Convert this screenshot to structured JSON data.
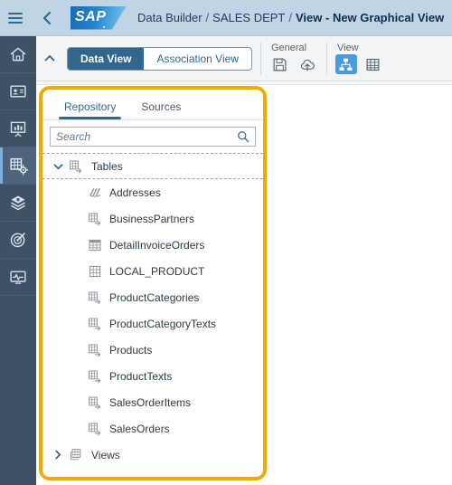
{
  "header": {
    "menu_icon": "hamburger-icon",
    "back_icon": "chevron-left-icon",
    "logo_text": "SAP",
    "breadcrumb": {
      "items": [
        "Data Builder",
        "SALES DEPT"
      ],
      "separator": "/",
      "current": "View - New Graphical View"
    }
  },
  "rail": {
    "items": [
      {
        "name": "home",
        "icon": "home-icon",
        "active": false
      },
      {
        "name": "catalog",
        "icon": "id-card-icon",
        "active": false
      },
      {
        "name": "story",
        "icon": "presentation-board-icon",
        "active": false
      },
      {
        "name": "data-builder",
        "icon": "data-builder-icon",
        "active": true
      },
      {
        "name": "business-builder",
        "icon": "layers-icon",
        "active": false
      },
      {
        "name": "planning",
        "icon": "target-icon",
        "active": false
      },
      {
        "name": "system-monitor",
        "icon": "monitor-pulse-icon",
        "active": false
      }
    ]
  },
  "toolbar": {
    "collapse_icon": "chevron-up-icon",
    "segmented": {
      "options": [
        "Data View",
        "Association View"
      ],
      "selected": "Data View"
    },
    "groups": [
      {
        "label": "General",
        "buttons": [
          {
            "name": "save",
            "icon": "save-floppy-icon",
            "active": false
          },
          {
            "name": "deploy",
            "icon": "cloud-upload-icon",
            "active": false
          }
        ]
      },
      {
        "label": "View",
        "buttons": [
          {
            "name": "graphical-view",
            "icon": "hierarchy-icon",
            "active": true
          },
          {
            "name": "table-view",
            "icon": "grid-table-icon",
            "active": false
          }
        ]
      }
    ]
  },
  "panel": {
    "highlight_color": "#f0ab00",
    "tabs": [
      {
        "label": "Repository",
        "active": true
      },
      {
        "label": "Sources",
        "active": false
      }
    ],
    "search": {
      "placeholder": "Search",
      "value": "",
      "icon": "search-icon"
    },
    "tree": [
      {
        "label": "Tables",
        "icon": "remote-table-icon",
        "chevron": "chevron-down-icon",
        "expanded": true,
        "level": 0,
        "selected": true
      },
      {
        "label": "Addresses",
        "icon": "local-table-stack-icon",
        "level": 1
      },
      {
        "label": "BusinessPartners",
        "icon": "remote-table-icon",
        "level": 1
      },
      {
        "label": "DetailInvoiceOrders",
        "icon": "view-table-icon",
        "level": 1
      },
      {
        "label": "LOCAL_PRODUCT",
        "icon": "grid-table-icon",
        "level": 1
      },
      {
        "label": "ProductCategories",
        "icon": "remote-table-icon",
        "level": 1
      },
      {
        "label": "ProductCategoryTexts",
        "icon": "remote-table-icon",
        "level": 1
      },
      {
        "label": "Products",
        "icon": "remote-table-icon",
        "level": 1
      },
      {
        "label": "ProductTexts",
        "icon": "remote-table-icon",
        "level": 1
      },
      {
        "label": "SalesOrderItems",
        "icon": "remote-table-icon",
        "level": 1
      },
      {
        "label": "SalesOrders",
        "icon": "remote-table-icon",
        "level": 1
      },
      {
        "label": "Views",
        "icon": "views-stack-icon",
        "chevron": "chevron-right-icon",
        "expanded": false,
        "level": 0
      }
    ]
  },
  "colors": {
    "header_bg": "#bfd4e4",
    "rail_bg": "#3d5167",
    "accent_blue": "#31678e",
    "active_icon_blue": "#4a9ae0",
    "highlight_orange": "#f0ab00"
  }
}
